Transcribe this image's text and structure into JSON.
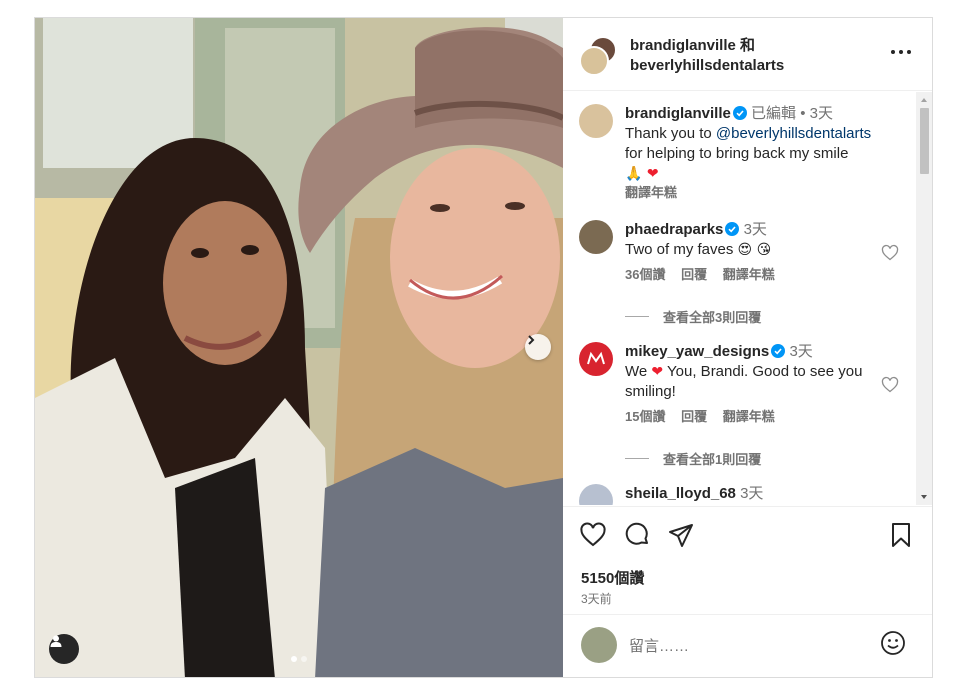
{
  "post": {
    "header_title_line1": "brandiglanville 和",
    "header_title_line2": "beverlyhillsdentalarts"
  },
  "caption": {
    "username": "brandiglanville",
    "meta": "已編輯 • 3天",
    "text_before": "Thank you to ",
    "mention": "@beverlyhillsdentalarts",
    "text_after": "for helping to bring back my smile",
    "emojis": "🙏 ❤",
    "translate": "翻譯年糕"
  },
  "comments": [
    {
      "username": "phaedraparks",
      "meta": "3天",
      "text": "Two of my faves",
      "emojis": "😍 😘",
      "likes": "36個讚",
      "reply": "回覆",
      "translate": "翻譯年糕",
      "view_replies": "查看全部3則回覆"
    },
    {
      "username": "mikey_yaw_designs",
      "meta": "3天",
      "text_before": "We ",
      "emoji_mid": "❤",
      "text_after": " You, Brandi. Good to see you smiling!",
      "likes": "15個讚",
      "reply": "回覆",
      "translate": "翻譯年糕",
      "view_replies": "查看全部1則回覆"
    },
    {
      "username": "sheila_lloyd_68",
      "meta": "3天"
    }
  ],
  "actions": {
    "likes": "5150個讚",
    "time": "3天前"
  },
  "comment_input": {
    "placeholder": "留言……"
  },
  "icons": [
    "more-icon",
    "verified-icon",
    "heart-icon",
    "comment-icon",
    "share-icon",
    "bookmark-icon",
    "emoji-icon",
    "chevron-right-icon",
    "user-tag-icon"
  ],
  "colors": {
    "verified": "#0095f6",
    "link": "#00376b",
    "muted": "#737373",
    "heart_red": "#ed1f2f"
  }
}
